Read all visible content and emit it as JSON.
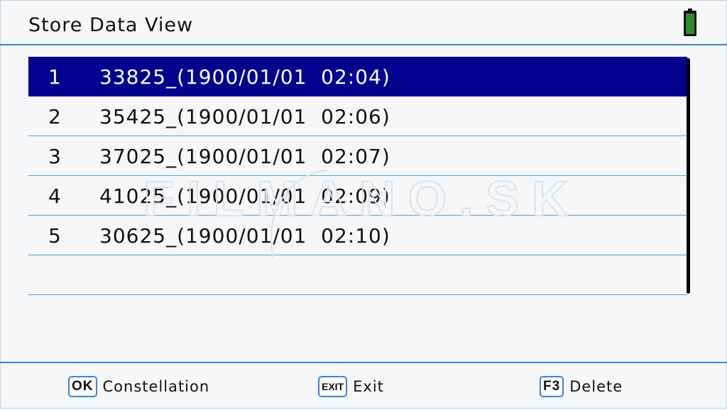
{
  "header": {
    "title": "Store Data View",
    "battery_color": "#2e8b2e"
  },
  "list": {
    "selected_index": 0,
    "items": [
      {
        "num": "1",
        "name": "33825_(1900/01/01  02:04)"
      },
      {
        "num": "2",
        "name": "35425_(1900/01/01  02:06)"
      },
      {
        "num": "3",
        "name": "37025_(1900/01/01  02:07)"
      },
      {
        "num": "4",
        "name": "41025_(1900/01/01  02:09)"
      },
      {
        "num": "5",
        "name": "30625_(1900/01/01  02:10)"
      }
    ]
  },
  "watermark": {
    "text": "FILMANO.SK"
  },
  "footer": {
    "ok": {
      "key": "OK",
      "label": "Constellation"
    },
    "exit": {
      "key": "EXIT",
      "label": "Exit"
    },
    "f3": {
      "key": "F3",
      "label": "Delete"
    }
  },
  "colors": {
    "selection": "#02028f",
    "accent": "#3a86c8"
  }
}
